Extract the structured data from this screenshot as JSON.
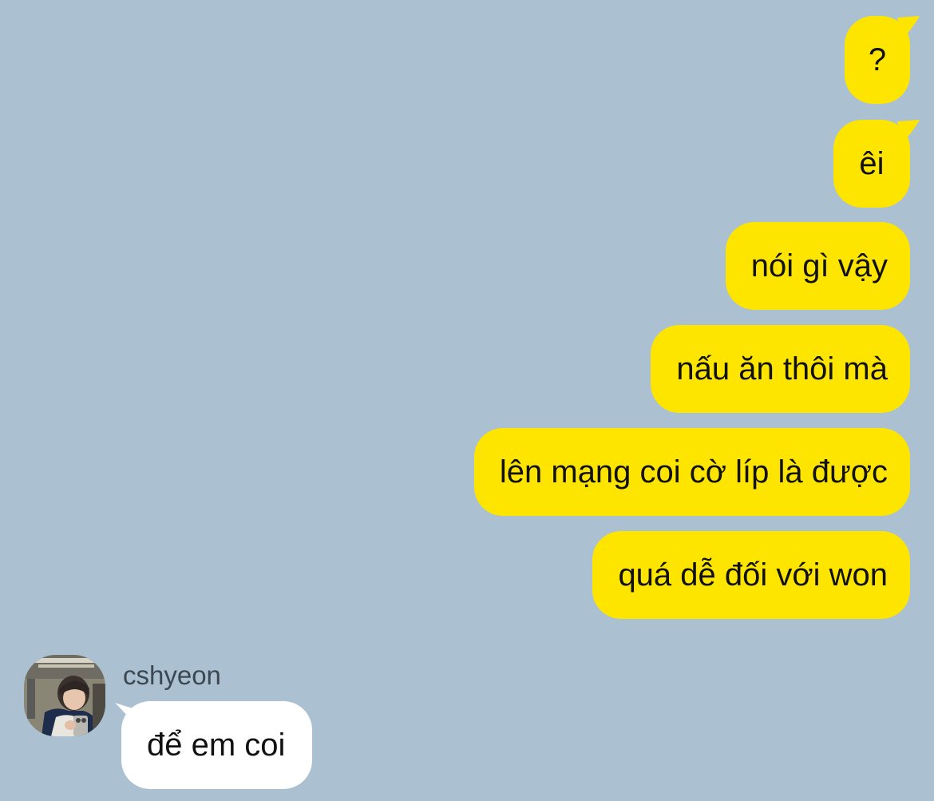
{
  "conversation": {
    "outgoing": [
      {
        "text": "?"
      },
      {
        "text": "êi"
      },
      {
        "text": "nói gì vậy"
      },
      {
        "text": "nấu ăn thôi mà"
      },
      {
        "text": "lên mạng coi cờ líp là được"
      },
      {
        "text": "quá dễ đối với won"
      }
    ],
    "incoming": {
      "sender": "cshyeon",
      "avatar_icon": "profile-photo-avatar",
      "messages": [
        {
          "text": "để em coi"
        }
      ]
    }
  },
  "colors": {
    "background": "#abc1d1",
    "outgoing_bubble": "#fee500",
    "incoming_bubble": "#ffffff",
    "text": "#111111",
    "sender_name": "#3b4852"
  }
}
